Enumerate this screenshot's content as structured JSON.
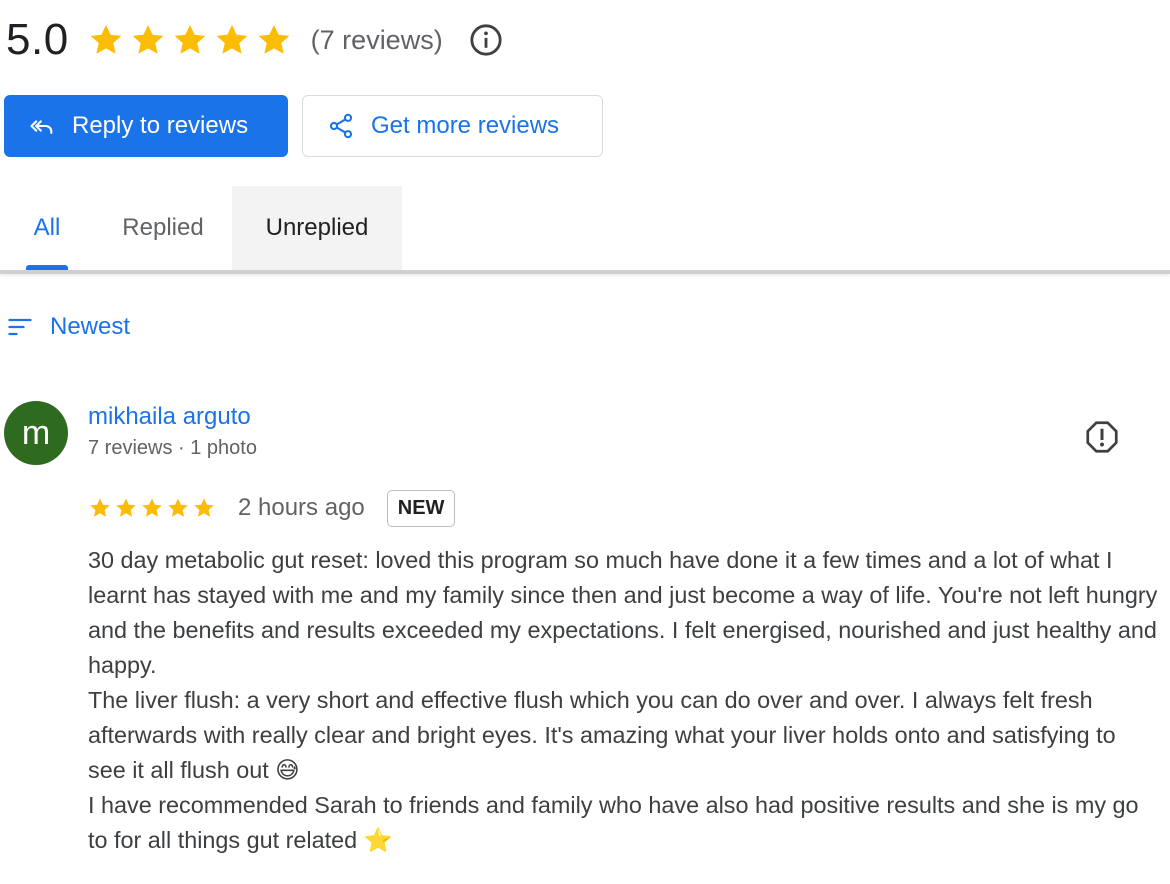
{
  "summary": {
    "rating": "5.0",
    "stars": 5,
    "reviews_count": "(7 reviews)"
  },
  "buttons": {
    "reply": "Reply to reviews",
    "get_more": "Get more reviews"
  },
  "tabs": [
    {
      "label": "All",
      "active": true
    },
    {
      "label": "Replied",
      "active": false
    },
    {
      "label": "Unreplied",
      "active": false
    }
  ],
  "sort": {
    "label": "Newest"
  },
  "review": {
    "avatar_letter": "m",
    "avatar_color": "#2e6b1f",
    "name": "mikhaila arguto",
    "meta": "7 reviews · 1 photo",
    "stars": 5,
    "time": "2 hours ago",
    "badge": "NEW",
    "text": [
      "30 day metabolic gut reset: loved this program so much have done it a few times and a lot of what I learnt has stayed with me and my family since then and just become a way of life. You're not left hungry and the benefits and results exceeded my expectations. I felt energised, nourished and just healthy and happy.",
      "The liver flush: a very short and effective flush which you can do over and over. I always felt fresh afterwards with really clear and bright eyes. It's amazing what your liver holds onto and satisfying to see it all flush out 😅",
      "I have recommended Sarah to friends and family who have also had positive results and she is my go to for all things gut related ⭐"
    ]
  },
  "colors": {
    "accent": "#1a73e8",
    "star": "#fbbc04"
  }
}
